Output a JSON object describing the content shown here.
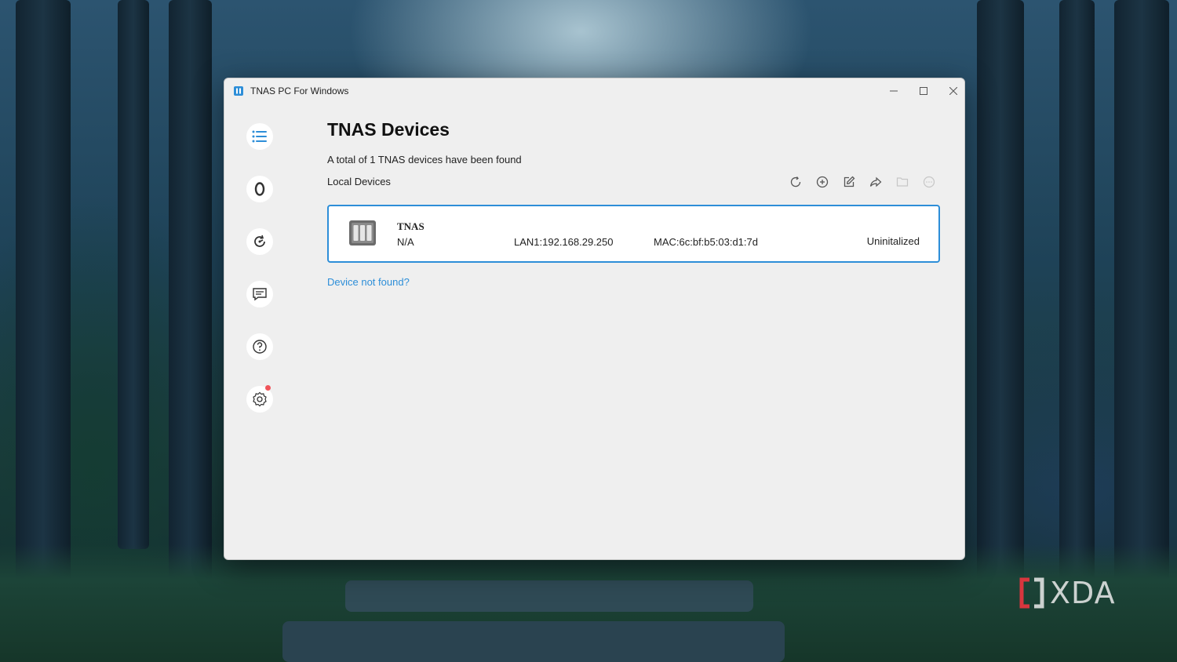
{
  "window": {
    "title": "TNAS PC For Windows"
  },
  "window_controls": {
    "minimize": "minimize-icon",
    "maximize": "maximize-icon",
    "close": "close-icon"
  },
  "sidebar": {
    "items": [
      {
        "name": "devices",
        "icon": "list-icon",
        "active": true
      },
      {
        "name": "tnas-id",
        "icon": "zero-icon"
      },
      {
        "name": "remote",
        "icon": "speed-refresh-icon"
      },
      {
        "name": "messages",
        "icon": "message-icon"
      },
      {
        "name": "help",
        "icon": "help-icon"
      },
      {
        "name": "settings",
        "icon": "gear-icon",
        "has_notification": true
      }
    ]
  },
  "main": {
    "title": "TNAS Devices",
    "summary": "A total of 1 TNAS devices have been found",
    "section_label": "Local Devices",
    "toolbar": [
      {
        "name": "refresh",
        "icon": "refresh-icon",
        "enabled": true
      },
      {
        "name": "add",
        "icon": "add-circle-icon",
        "enabled": true
      },
      {
        "name": "edit",
        "icon": "edit-icon",
        "enabled": true
      },
      {
        "name": "share",
        "icon": "share-icon",
        "enabled": true
      },
      {
        "name": "folder",
        "icon": "folder-icon",
        "enabled": false
      },
      {
        "name": "more",
        "icon": "more-icon",
        "enabled": false
      }
    ],
    "devices": [
      {
        "name": "TNAS",
        "model": "N/A",
        "lan": "LAN1:192.168.29.250",
        "mac": "MAC:6c:bf:b5:03:d1:7d",
        "status": "Uninitalized"
      }
    ],
    "help_link": "Device not found?"
  },
  "colors": {
    "accent": "#2d8ed8",
    "window_bg": "#efefef",
    "notification": "#f0545a"
  },
  "watermark": {
    "text": "XDA"
  }
}
